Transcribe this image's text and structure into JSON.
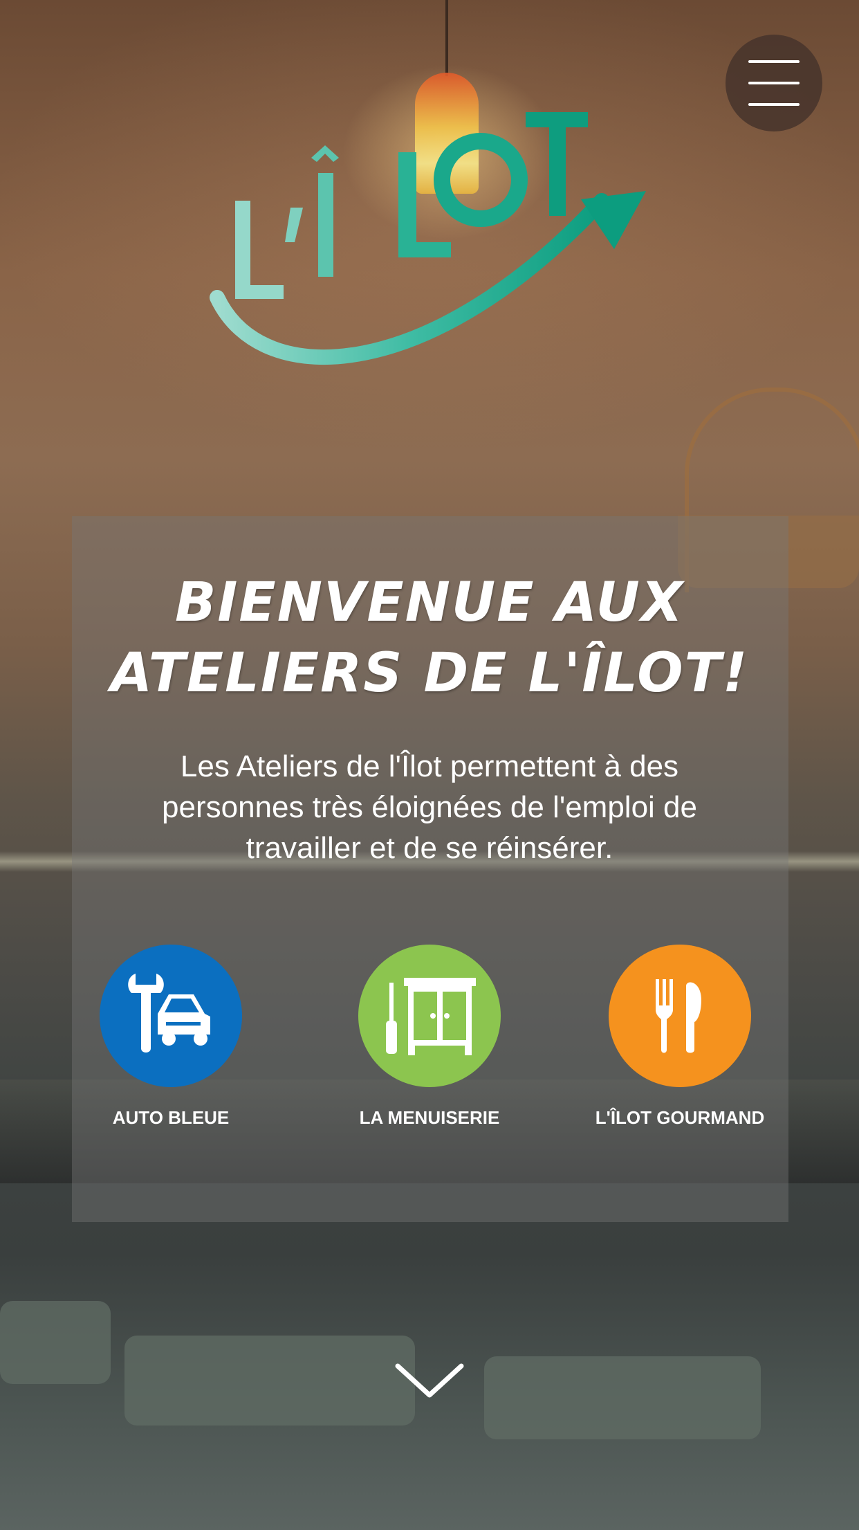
{
  "header": {
    "menu_icon": "hamburger-menu-icon",
    "logo": {
      "text": "L'ÎLOT",
      "colors": [
        "#8fd6c6",
        "#12a98a",
        "#0e9a7c"
      ]
    }
  },
  "hero": {
    "title_line1": "Bienvenue aux",
    "title_line2": "ateliers de l'Îlot!",
    "description": "Les Ateliers de l'Îlot permettent à des personnes très éloignées de l'emploi de travailler et de se réinsérer."
  },
  "workshops": [
    {
      "label": "AUTO BLEUE",
      "icon": "wrench-car-icon",
      "color": "#0b6fc0"
    },
    {
      "label": "LA MENUISERIE",
      "icon": "cupboard-screwdriver-icon",
      "color": "#8cc54f"
    },
    {
      "label": "L'ÎLOT GOURMAND",
      "icon": "fork-knife-icon",
      "color": "#f5921e"
    }
  ],
  "scroll": {
    "icon": "chevron-down-icon"
  }
}
